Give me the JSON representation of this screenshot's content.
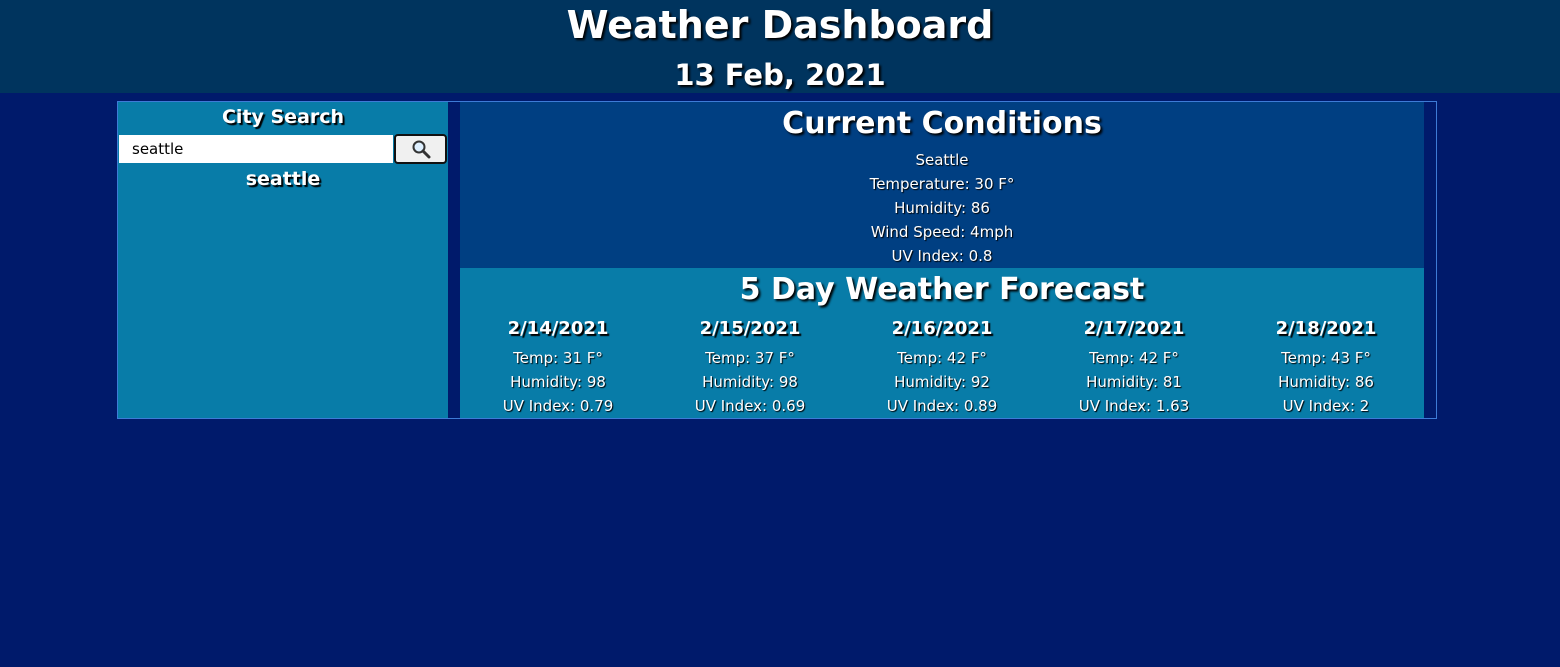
{
  "header": {
    "title": "Weather Dashboard",
    "date": "13 Feb, 2021"
  },
  "sidebar": {
    "title": "City Search",
    "search_value": "seattle",
    "search_icon": "magnifier-icon",
    "history": [
      "seattle"
    ]
  },
  "current": {
    "title": "Current Conditions",
    "city": "Seattle",
    "temperature": "Temperature: 30 F°",
    "humidity": "Humidity: 86",
    "wind": "Wind Speed: 4mph",
    "uv": "UV Index: 0.8"
  },
  "forecast": {
    "title": "5 Day Weather Forecast",
    "days": [
      {
        "date": "2/14/2021",
        "temp": "Temp: 31 F°",
        "humidity": "Humidity: 98",
        "uv": "UV Index: 0.79"
      },
      {
        "date": "2/15/2021",
        "temp": "Temp: 37 F°",
        "humidity": "Humidity: 98",
        "uv": "UV Index: 0.69"
      },
      {
        "date": "2/16/2021",
        "temp": "Temp: 42 F°",
        "humidity": "Humidity: 92",
        "uv": "UV Index: 0.89"
      },
      {
        "date": "2/17/2021",
        "temp": "Temp: 42 F°",
        "humidity": "Humidity: 81",
        "uv": "UV Index: 1.63"
      },
      {
        "date": "2/18/2021",
        "temp": "Temp: 43 F°",
        "humidity": "Humidity: 86",
        "uv": "UV Index: 2"
      }
    ]
  },
  "colors": {
    "page_bg": "#001a6b",
    "header_bg": "#00345e",
    "panel_teal": "#087ca8",
    "current_bg": "#003f82"
  }
}
